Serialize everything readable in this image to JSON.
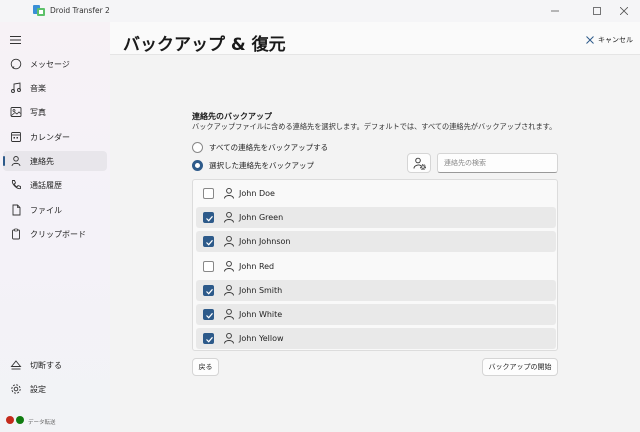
{
  "window": {
    "title": "Droid Transfer 2",
    "minimize": "—",
    "maximize": "☐",
    "close": "✕"
  },
  "sidebar": {
    "items": [
      {
        "label": "メッセージ",
        "icon": "message-icon"
      },
      {
        "label": "音楽",
        "icon": "music-icon"
      },
      {
        "label": "写真",
        "icon": "photo-icon"
      },
      {
        "label": "カレンダー",
        "icon": "calendar-icon"
      },
      {
        "label": "連絡先",
        "icon": "contacts-icon",
        "active": true
      },
      {
        "label": "通話履歴",
        "icon": "phone-icon"
      },
      {
        "label": "ファイル",
        "icon": "file-icon"
      },
      {
        "label": "クリップボード",
        "icon": "clipboard-icon"
      }
    ],
    "bottom_items": [
      {
        "label": "切断する",
        "icon": "eject-icon"
      },
      {
        "label": "設定",
        "icon": "gear-icon"
      }
    ],
    "status": {
      "label": "データ転送",
      "dot_colors": [
        "#c42b1c",
        "#107c10"
      ]
    }
  },
  "header": {
    "title": "バックアップ & 復元",
    "cancel_label": "キャンセル"
  },
  "section": {
    "title": "連絡先のバックアップ",
    "description": "バックアップファイルに含める連絡先を選択します。デフォルトでは、すべての連絡先がバックアップされます。"
  },
  "options": {
    "all_label": "すべての連絡先をバックアップする",
    "selected_label": "選択した連絡先をバックアップ",
    "selected_option": "selected"
  },
  "search": {
    "placeholder": "連絡先の検索",
    "value": ""
  },
  "contacts": [
    {
      "name": "John Doe",
      "checked": false
    },
    {
      "name": "John Green",
      "checked": true
    },
    {
      "name": "John Johnson",
      "checked": true
    },
    {
      "name": "John Red",
      "checked": false
    },
    {
      "name": "John Smith",
      "checked": true
    },
    {
      "name": "John White",
      "checked": true
    },
    {
      "name": "John Yellow",
      "checked": true
    }
  ],
  "buttons": {
    "back": "戻る",
    "start": "バックアップの開始"
  },
  "colors": {
    "accent": "#2d5a8a"
  }
}
